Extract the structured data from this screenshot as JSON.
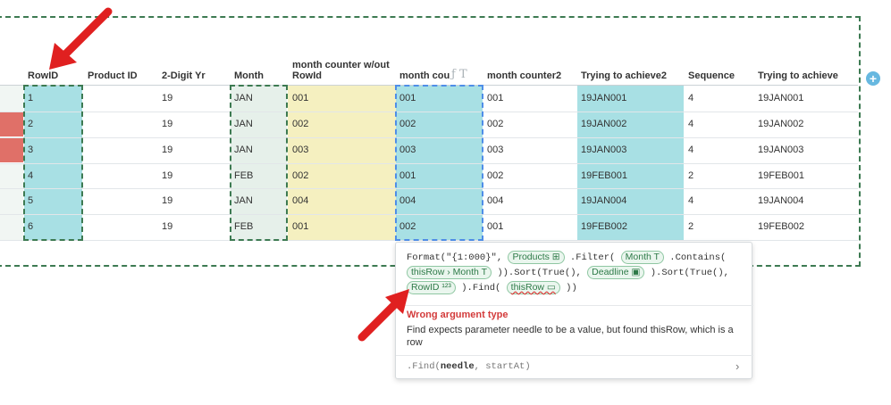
{
  "table": {
    "columns": [
      {
        "key": "rowid",
        "label": "RowID"
      },
      {
        "key": "product_id",
        "label": "Product ID"
      },
      {
        "key": "digit_yr",
        "label": "2-Digit Yr"
      },
      {
        "key": "month",
        "label": "Month"
      },
      {
        "key": "mc_wo",
        "label": "month counter w/out RowId"
      },
      {
        "key": "mc",
        "label": "month cou"
      },
      {
        "key": "mc2",
        "label": "month counter2"
      },
      {
        "key": "tta2",
        "label": "Trying to achieve2"
      },
      {
        "key": "seq",
        "label": "Sequence"
      },
      {
        "key": "tta",
        "label": "Trying to achieve"
      }
    ],
    "rows": [
      {
        "rowid": "1",
        "product_id": "",
        "digit_yr": "19",
        "month": "JAN",
        "mc_wo": "001",
        "mc": "001",
        "mc2": "001",
        "tta2": "19JAN001",
        "seq": "4",
        "tta": "19JAN001"
      },
      {
        "rowid": "2",
        "product_id": "",
        "digit_yr": "19",
        "month": "JAN",
        "mc_wo": "002",
        "mc": "002",
        "mc2": "002",
        "tta2": "19JAN002",
        "seq": "4",
        "tta": "19JAN002"
      },
      {
        "rowid": "3",
        "product_id": "",
        "digit_yr": "19",
        "month": "JAN",
        "mc_wo": "003",
        "mc": "003",
        "mc2": "003",
        "tta2": "19JAN003",
        "seq": "4",
        "tta": "19JAN003"
      },
      {
        "rowid": "4",
        "product_id": "",
        "digit_yr": "19",
        "month": "FEB",
        "mc_wo": "002",
        "mc": "001",
        "mc2": "002",
        "tta2": "19FEB001",
        "seq": "2",
        "tta": "19FEB001"
      },
      {
        "rowid": "5",
        "product_id": "",
        "digit_yr": "19",
        "month": "JAN",
        "mc_wo": "004",
        "mc": "004",
        "mc2": "004",
        "tta2": "19JAN004",
        "seq": "4",
        "tta": "19JAN004"
      },
      {
        "rowid": "6",
        "product_id": "",
        "digit_yr": "19",
        "month": "FEB",
        "mc_wo": "001",
        "mc": "002",
        "mc2": "001",
        "tta2": "19FEB002",
        "seq": "2",
        "tta": "19FEB002"
      }
    ],
    "header_icons": {
      "formula": "ƒ",
      "type": "T"
    },
    "add_column": "+"
  },
  "formula": {
    "line1_a": "Format(\"{1:000}\",",
    "products": "Products ⊞",
    "line1_b": ".Filter(",
    "month_chip": "Month T",
    "line1_c": ".Contains(",
    "thisrow_month": "thisRow › Month T",
    "line2_b": ")).Sort(True(),",
    "deadline": "Deadline ▣",
    "line2_c": ").Sort(True(),",
    "rowid_chip": "RowID ¹²³",
    "line3_b": ").Find(",
    "thisrow": "thisRow ▭",
    "line3_c": "))"
  },
  "error": {
    "title": "Wrong argument type",
    "message": "Find expects parameter needle to be a value, but found thisRow, which is a row"
  },
  "signature": {
    "prefix": ".Find(",
    "param1": "needle",
    "rest": ", startAt)",
    "chevron": "›"
  },
  "colors": {
    "teal": "#a8e0e4",
    "yellow": "#f5f0c0",
    "mint": "#e6f0ea",
    "red": "#e07068",
    "dashed_green": "#3d7a52",
    "dashed_blue": "#4f8ee8",
    "arrow_red": "#e02020",
    "error_red": "#d33b3b"
  }
}
